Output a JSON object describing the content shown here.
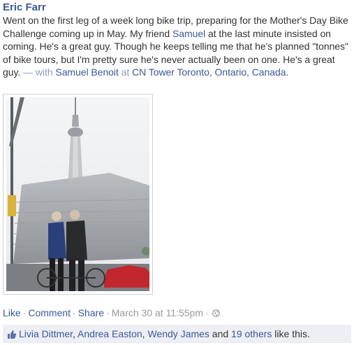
{
  "post": {
    "author": "Eric Farr",
    "message_before": "Went on the first leg of a week long bike trip, preparing for the Mother's Day Bike Challenge coming up in May. My friend ",
    "mention": "Samuel",
    "message_after": " at the last minute insisted on coming. He's a great guy. Though he keeps telling me that he's planned \"tonnes\" of bike tours, but I'm pretty sure he's never actually been on one. He's a great guy.",
    "with_sep": " — with ",
    "tagged_person": "Samuel Benoit",
    "at_word": " at ",
    "location": "CN Tower Toronto, Ontario, Canada."
  },
  "photo": {
    "icon": "photo-icon"
  },
  "actions": {
    "like": "Like",
    "comment": "Comment",
    "share": "Share",
    "separator": "·",
    "timestamp": "March 30 at 11:55pm",
    "privacy_icon": "globe-icon"
  },
  "likes": {
    "icon": "thumbs-up-icon",
    "names": [
      "Livia Dittmer",
      "Andrea Easton",
      "Wendy James"
    ],
    "comma": ", ",
    "and_word": " and ",
    "others": "19 others",
    "suffix": " like this."
  },
  "colors": {
    "link": "#3b5998",
    "muted": "#999999",
    "likes_bg": "#edeff4"
  }
}
